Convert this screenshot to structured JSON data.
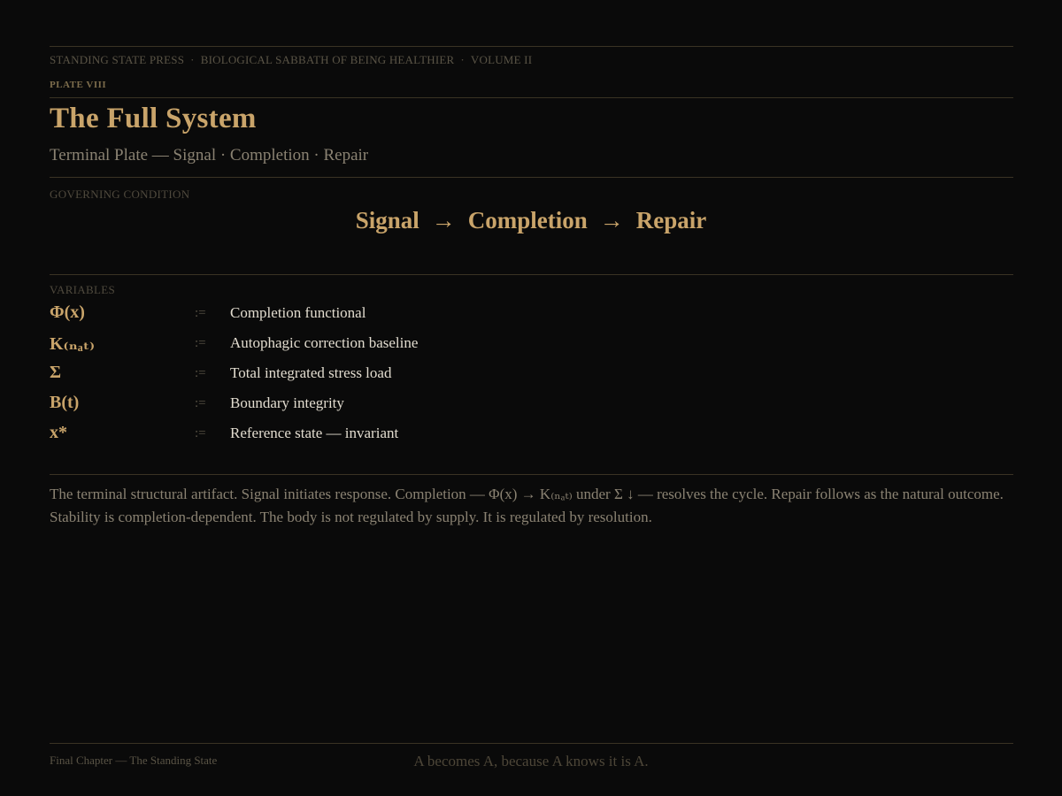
{
  "header": {
    "publisher": "STANDING STATE PRESS",
    "separator": "·",
    "series": "BIOLOGICAL SABBATH OF BEING HEALTHIER",
    "volume": "VOLUME II",
    "plate": "PLATE VIII"
  },
  "title": "The Full System",
  "subtitle": "Terminal Plate — Signal · Completion · Repair",
  "governing": {
    "label": "GOVERNING CONDITION",
    "terms": [
      "Signal",
      "Completion",
      "Repair"
    ],
    "arrow": "→"
  },
  "variables": {
    "label": "VARIABLES",
    "define_symbol": ":=",
    "items": [
      {
        "symbol": "Φ(x)",
        "description": "Completion functional"
      },
      {
        "symbol": "K₍ₙₐₜ₎",
        "description": "Autophagic correction baseline"
      },
      {
        "symbol": "Σ",
        "description": "Total integrated stress load"
      },
      {
        "symbol": "B(t)",
        "description": "Boundary integrity"
      },
      {
        "symbol": "x*",
        "description": "Reference state — invariant"
      }
    ]
  },
  "body_text": "The terminal structural artifact. Signal initiates response. Completion — Φ(x) → K₍ₙₐₜ₎ under Σ ↓ — resolves the cycle. Repair follows as the natural outcome. Stability is completion-dependent. The body is not regulated by supply. It is regulated by resolution.",
  "footer": {
    "left": "Final Chapter — The Standing State",
    "center": "A becomes A, because A knows it is A."
  }
}
